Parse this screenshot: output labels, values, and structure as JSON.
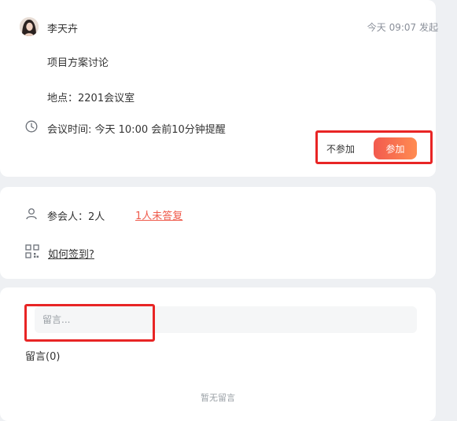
{
  "meeting": {
    "organizer": "李天卉",
    "initiated": "今天 09:07 发起",
    "topic": "项目方案讨论",
    "location": "地点：2201会议室",
    "time": "会议时间: 今天 10:00 会前10分钟提醒",
    "decline_label": "不参加",
    "join_label": "参加"
  },
  "attendees": {
    "label": "参会人：2人",
    "unreplied": "1人未答复",
    "checkin_help": "如何签到?"
  },
  "comments": {
    "placeholder": "留言...",
    "count_label": "留言(0)",
    "empty": "暂无留言"
  },
  "colors": {
    "accent": "#f25a4e",
    "accent_end": "#ff8c52",
    "highlight_box": "#e82525",
    "page_bg": "#eef0f3"
  }
}
